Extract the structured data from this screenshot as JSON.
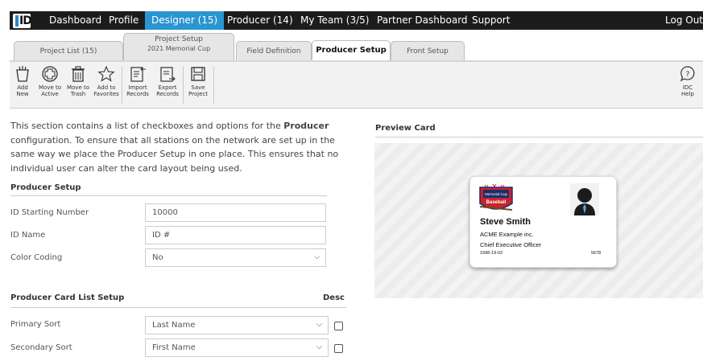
{
  "nav": {
    "logo": "ID",
    "items": [
      {
        "label": "Dashboard"
      },
      {
        "label": "Profile"
      },
      {
        "label": "Designer (15)"
      },
      {
        "label": "Producer (14)"
      },
      {
        "label": "My Team (3/5)"
      },
      {
        "label": "Partner Dashboard"
      },
      {
        "label": "Support"
      }
    ],
    "logout": "Log Out",
    "active_color": "#2a95d0"
  },
  "tabs": [
    {
      "label": "Project List (15)"
    },
    {
      "label": "Project Setup",
      "sub": "2021 Memorial Cup"
    },
    {
      "label": "Field Definition"
    },
    {
      "label": "Producer Setup"
    },
    {
      "label": "Front Setup"
    }
  ],
  "toolbar": [
    {
      "l1": "Add",
      "l2": "New",
      "icon": "add-new-icon"
    },
    {
      "l1": "Move to",
      "l2": "Active",
      "icon": "move-active-icon"
    },
    {
      "l1": "Move to",
      "l2": "Trash",
      "icon": "trash-icon"
    },
    {
      "l1": "Add to",
      "l2": "Favorites",
      "icon": "star-icon"
    },
    {
      "l1": "Import",
      "l2": "Records",
      "icon": "import-icon"
    },
    {
      "l1": "Export",
      "l2": "Records",
      "icon": "export-icon"
    },
    {
      "l1": "Save",
      "l2": "Project",
      "icon": "save-icon"
    },
    {
      "l1": "IDC",
      "l2": "Help",
      "icon": "help-icon"
    }
  ],
  "intro": {
    "pre": "This section contains a list of checkboxes and options for the ",
    "bold": "Producer",
    "post": " configuration. To ensure that all stations on the network are set up in the same way we place the Producer Setup in one place. This ensures that no individual user can alter the card layout being used."
  },
  "producer_setup": {
    "title": "Producer Setup",
    "fields": [
      {
        "label": "ID Starting Number",
        "value": "10000"
      },
      {
        "label": "ID Name",
        "value": "ID #"
      },
      {
        "label": "Color Coding",
        "value": "No"
      }
    ]
  },
  "card_list": {
    "title": "Producer Card List Setup",
    "desc_label": "Desc",
    "rows": [
      {
        "label": "Primary Sort",
        "value": "Last Name"
      },
      {
        "label": "Secondary Sort",
        "value": "First Name"
      }
    ]
  },
  "preview": {
    "title": "Preview Card",
    "card": {
      "logo_line1": "Memorial Cup",
      "logo_line2": "Baseball",
      "name": "Steve Smith",
      "company": "ACME Example inc.",
      "job_title": "Chief Executive Officer",
      "date": "1998-19-02",
      "number": "5678"
    }
  }
}
